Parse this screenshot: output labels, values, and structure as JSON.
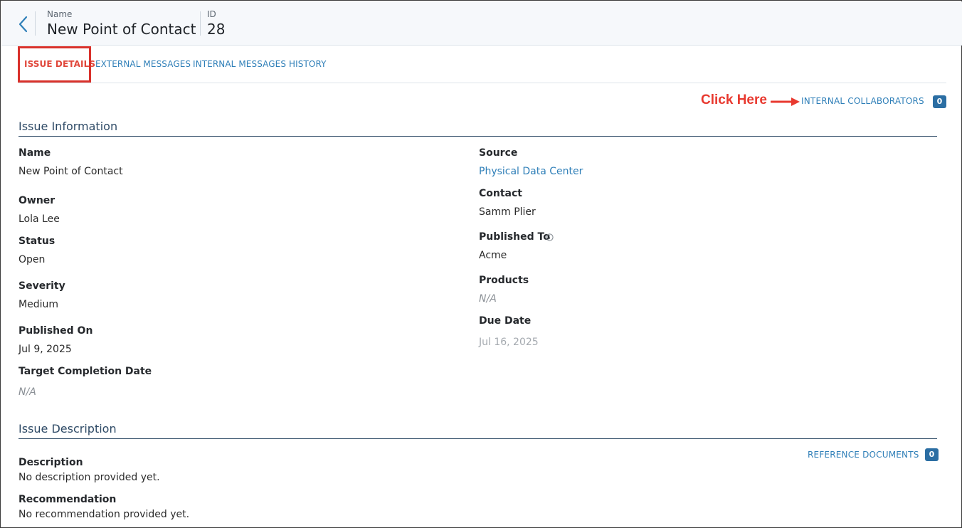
{
  "header": {
    "name_label": "Name",
    "name_value": "New Point of Contact",
    "id_label": "ID",
    "id_value": "28",
    "back_icon": "chevron-left-icon"
  },
  "tabs": [
    {
      "label": "ISSUE DETAILS",
      "active": true
    },
    {
      "label": "EXTERNAL MESSAGES",
      "active": false
    },
    {
      "label": "INTERNAL MESSAGES",
      "active": false
    },
    {
      "label": "HISTORY",
      "active": false
    }
  ],
  "annotation": {
    "text": "Click Here",
    "color": "#e8392f"
  },
  "collaborators": {
    "label": "INTERNAL COLLABORATORS",
    "count": "0"
  },
  "issue_information": {
    "title": "Issue Information",
    "left": [
      {
        "label": "Name",
        "value": "New Point of Contact"
      },
      {
        "label": "Owner",
        "value": "Lola Lee"
      },
      {
        "label": "Status",
        "value": "Open"
      },
      {
        "label": "Severity",
        "value": "Medium"
      },
      {
        "label": "Published On",
        "value": "Jul 9, 2025"
      },
      {
        "label": "Target Completion Date",
        "value": "N/A"
      }
    ],
    "right": [
      {
        "label": "Source",
        "value": "Physical Data Center"
      },
      {
        "label": "Contact",
        "value": "Samm Plier"
      },
      {
        "label": "Published To",
        "value": "Acme"
      },
      {
        "label": "Products",
        "value": "N/A"
      },
      {
        "label": "Due Date",
        "value": "Jul 16, 2025"
      }
    ]
  },
  "issue_description": {
    "title": "Issue Description",
    "reference_documents_label": "REFERENCE DOCUMENTS",
    "reference_documents_count": "0",
    "description_label": "Description",
    "description_value": "No description provided yet.",
    "recommendation_label": "Recommendation",
    "recommendation_value": "No recommendation provided yet."
  },
  "colors": {
    "accent": "#2f7fb8",
    "active_tab": "#e0463a",
    "section_title": "#2e4a66",
    "badge": "#2b6ea3"
  }
}
